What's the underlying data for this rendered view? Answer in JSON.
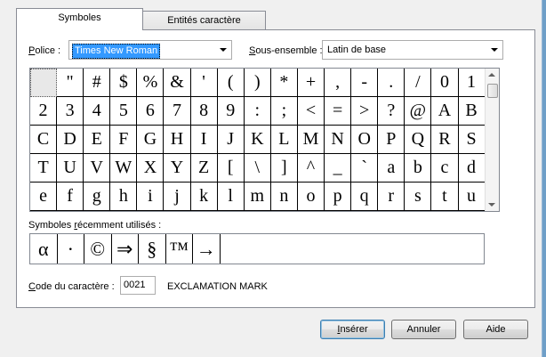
{
  "tabs": [
    {
      "label": "Symboles",
      "active": true
    },
    {
      "label": "Entités caractère",
      "active": false
    }
  ],
  "font": {
    "label": "Police :",
    "value": "Times New Roman"
  },
  "subset": {
    "label": "Sous-ensemble :",
    "value": "Latin de base"
  },
  "symbols": [
    "!",
    "\"",
    "#",
    "$",
    "%",
    "&",
    "'",
    "(",
    ")",
    "*",
    "+",
    ",",
    "-",
    ".",
    "/",
    "0",
    "1",
    "2",
    "3",
    "4",
    "5",
    "6",
    "7",
    "8",
    "9",
    ":",
    ";",
    "<",
    "=",
    ">",
    "?",
    "@",
    "A",
    "B",
    "C",
    "D",
    "E",
    "F",
    "G",
    "H",
    "I",
    "J",
    "K",
    "L",
    "M",
    "N",
    "O",
    "P",
    "Q",
    "R",
    "S",
    "T",
    "U",
    "V",
    "W",
    "X",
    "Y",
    "Z",
    "[",
    "\\",
    "]",
    "^",
    "_",
    "`",
    "a",
    "b",
    "c",
    "d",
    "e",
    "f",
    "g",
    "h",
    "i",
    "j",
    "k",
    "l",
    "m",
    "n",
    "o",
    "p",
    "q",
    "r",
    "s",
    "t",
    "u"
  ],
  "selected_symbol_index": 0,
  "recent": {
    "label": "Symboles récemment utilisés :",
    "items": [
      "α",
      "·",
      "©",
      "⇒",
      "§",
      "™",
      "→"
    ]
  },
  "code": {
    "label": "Code du caractère :",
    "value": "0021",
    "name": "EXCLAMATION MARK"
  },
  "buttons": {
    "insert": "Insérer",
    "cancel": "Annuler",
    "help": "Aide"
  },
  "colors": {
    "selection": "#3399ff",
    "window_edge": "#6f9fc8"
  }
}
